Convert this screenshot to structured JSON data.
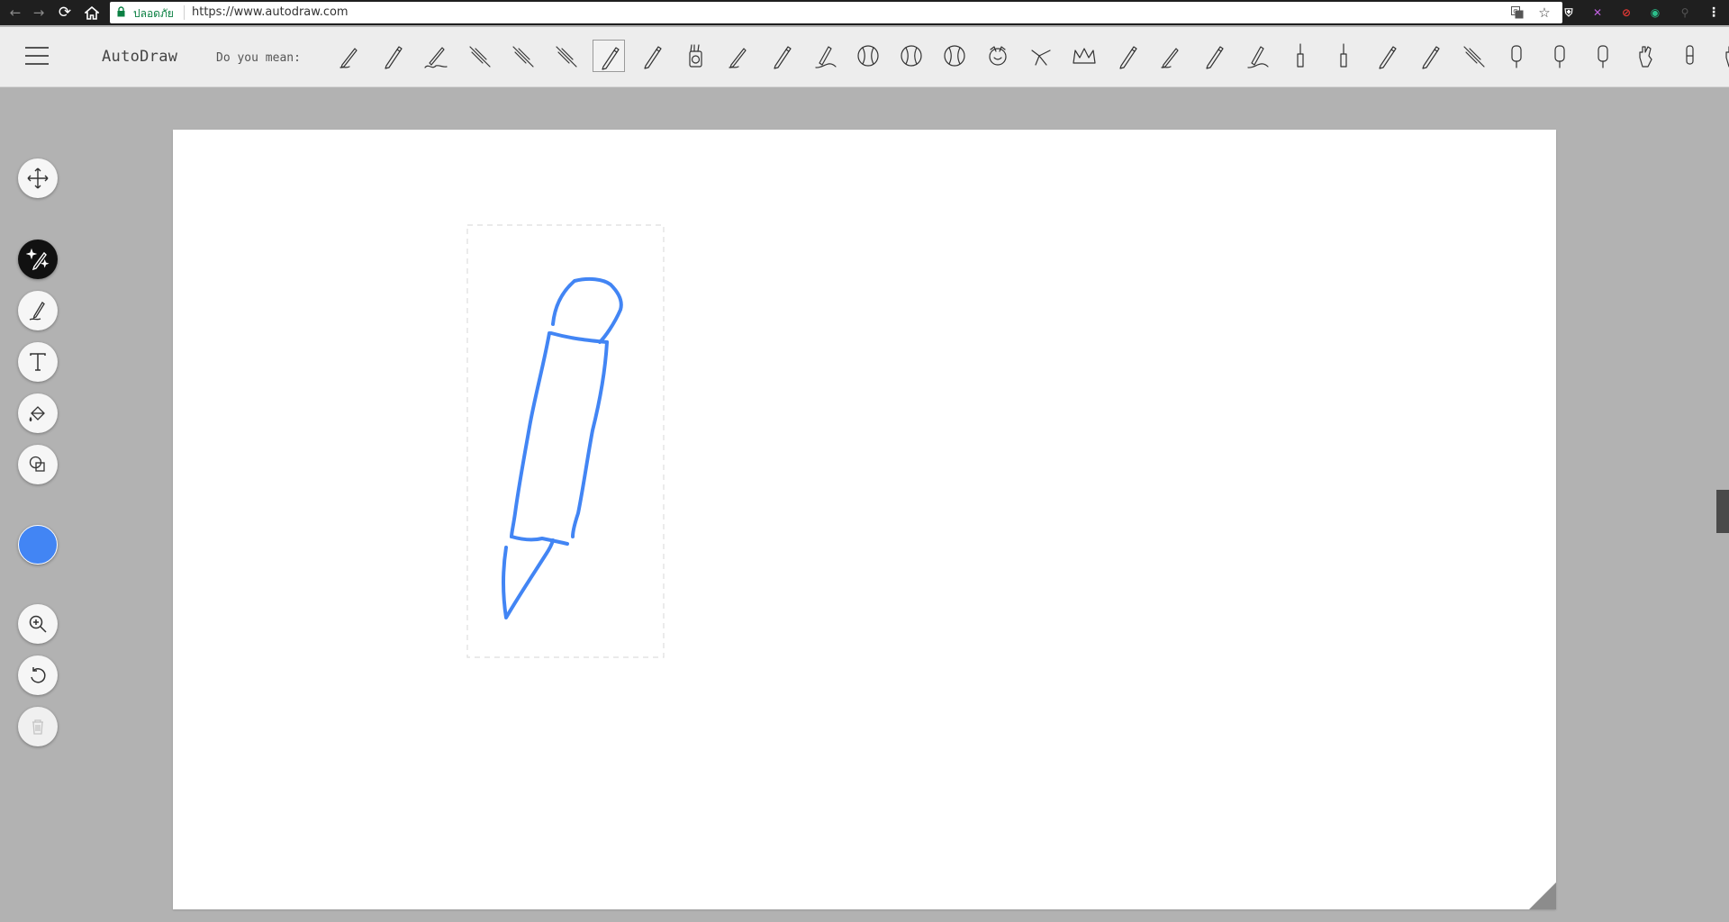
{
  "browser": {
    "secure_label": "ปลอดภัย",
    "url": "https://www.autodraw.com",
    "nav": {
      "back_icon": "back-arrow-icon",
      "forward_icon": "forward-arrow-icon",
      "reload_icon": "reload-icon",
      "home_icon": "home-icon"
    },
    "extensions": [
      {
        "name": "shield-extension-icon",
        "glyph": "⛨",
        "color": "#ffffff"
      },
      {
        "name": "x-extension-icon",
        "glyph": "✕",
        "color": "#c060e0"
      },
      {
        "name": "block-extension-icon",
        "glyph": "⊘",
        "color": "#e53935"
      },
      {
        "name": "eye-extension-icon",
        "glyph": "◉",
        "color": "#2bbf8a"
      },
      {
        "name": "pin-extension-icon",
        "glyph": "⚲",
        "color": "#555555"
      }
    ]
  },
  "app": {
    "title": "AutoDraw",
    "suggest_label": "Do you mean:",
    "accent_color": "#4285f4",
    "suggestions": [
      "pen-suggestion",
      "pencil-suggestion",
      "signature-pen-suggestion",
      "syringe-suggestion",
      "syringe-suggestion",
      "syringe-suggestion",
      "pencil-suggestion",
      "pencil-suggestion",
      "pencil-cup-suggestion",
      "pen-suggestion",
      "pencil-suggestion",
      "marker-suggestion",
      "baseball-suggestion",
      "baseball-suggestion",
      "baseball-suggestion",
      "face-suggestion",
      "bird-suggestion",
      "crown-suggestion",
      "pencil-suggestion",
      "pen-suggestion",
      "pencil-suggestion",
      "marker-suggestion",
      "screwdriver-suggestion",
      "screwdriver-suggestion",
      "pencil-suggestion",
      "pencil-suggestion",
      "syringe-suggestion",
      "popsicle-suggestion",
      "popsicle-suggestion",
      "popsicle-suggestion",
      "hand-suggestion",
      "finger-suggestion",
      "hand-suggestion"
    ],
    "selected_suggestion": "pencil"
  },
  "tools": {
    "move": "move-icon",
    "autodraw": "autodraw-icon",
    "draw": "draw-icon",
    "text": "text-icon",
    "fill": "fill-icon",
    "shape": "shape-icon",
    "color": "#4285f4",
    "zoom": "zoom-icon",
    "undo": "undo-icon",
    "delete": "delete-icon",
    "active_tool": "autodraw"
  },
  "drawing": {
    "stroke_color": "#4285f4"
  }
}
